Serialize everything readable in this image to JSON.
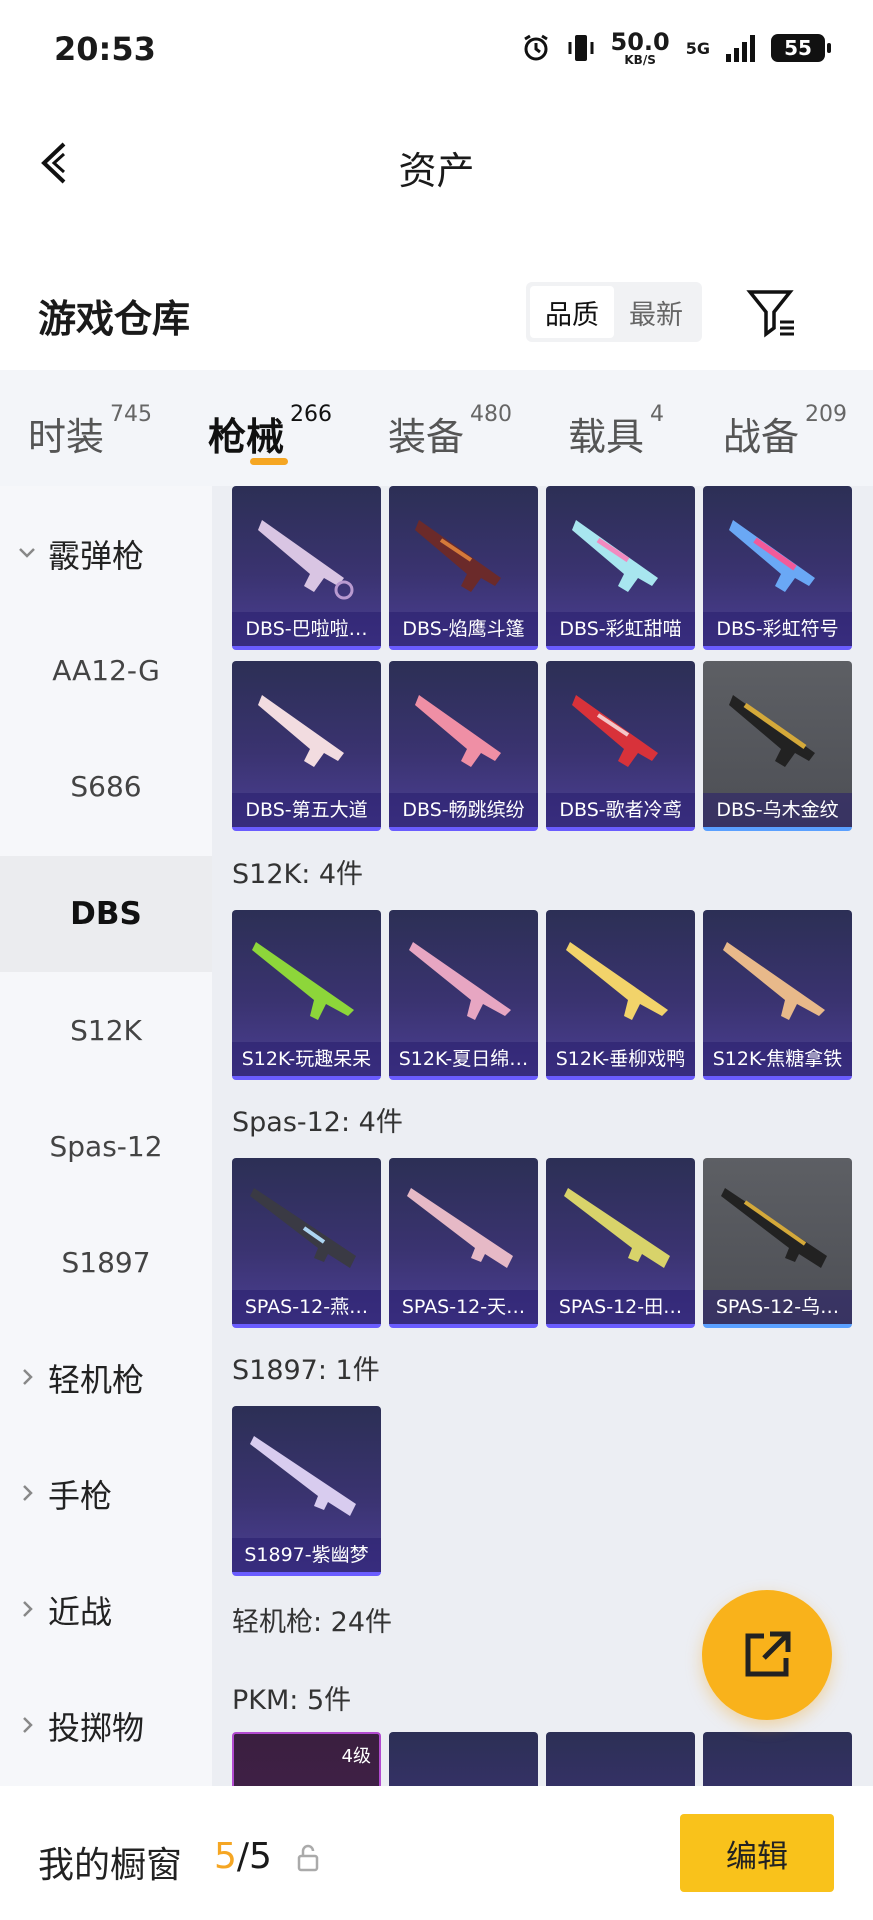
{
  "status_bar": {
    "time": "20:53",
    "net_speed": "50.0",
    "net_unit": "KB/S",
    "network": "5G",
    "battery": "55"
  },
  "header": {
    "title": "资产"
  },
  "warehouse": {
    "title": "游戏仓库",
    "sort_options": [
      "品质",
      "最新"
    ]
  },
  "tabs": [
    {
      "label": "时装",
      "count": "745"
    },
    {
      "label": "枪械",
      "count": "266"
    },
    {
      "label": "装备",
      "count": "480"
    },
    {
      "label": "载具",
      "count": "4"
    },
    {
      "label": "战备",
      "count": "209"
    }
  ],
  "sidebar": {
    "items": [
      "霰弹枪",
      "AA12-G",
      "S686",
      "DBS",
      "S12K",
      "Spas-12",
      "S1897",
      "轻机枪",
      "手枪",
      "近战",
      "投掷物"
    ]
  },
  "sections": {
    "s12k": "S12K: 4件",
    "spas": "Spas-12: 4件",
    "s1897": "S1897: 1件",
    "lmg": "轻机枪: 24件",
    "pkm": "PKM: 5件"
  },
  "items": {
    "dbs_row1": [
      "DBS-巴啦啦…",
      "DBS-焰鹰斗篷",
      "DBS-彩虹甜喵",
      "DBS-彩虹符号"
    ],
    "dbs_row2": [
      "DBS-第五大道",
      "DBS-畅跳缤纷",
      "DBS-歌者冷鸢",
      "DBS-乌木金纹"
    ],
    "s12k": [
      "S12K-玩趣呆呆",
      "S12K-夏日绵…",
      "S12K-垂柳戏鸭",
      "S12K-焦糖拿铁"
    ],
    "spas": [
      "SPAS-12-燕…",
      "SPAS-12-天…",
      "SPAS-12-田…",
      "SPAS-12-乌…"
    ],
    "s1897": [
      "S1897-紫幽梦"
    ],
    "pkm_badge": "4级"
  },
  "bottom": {
    "title": "我的橱窗",
    "count_a": "5",
    "count_b": "/5",
    "edit": "编辑"
  },
  "colors": {
    "accent": "#f5a623",
    "card_bg": "#3a3370",
    "fab": "#f9b21b",
    "edit_bg": "#f9c21b"
  }
}
